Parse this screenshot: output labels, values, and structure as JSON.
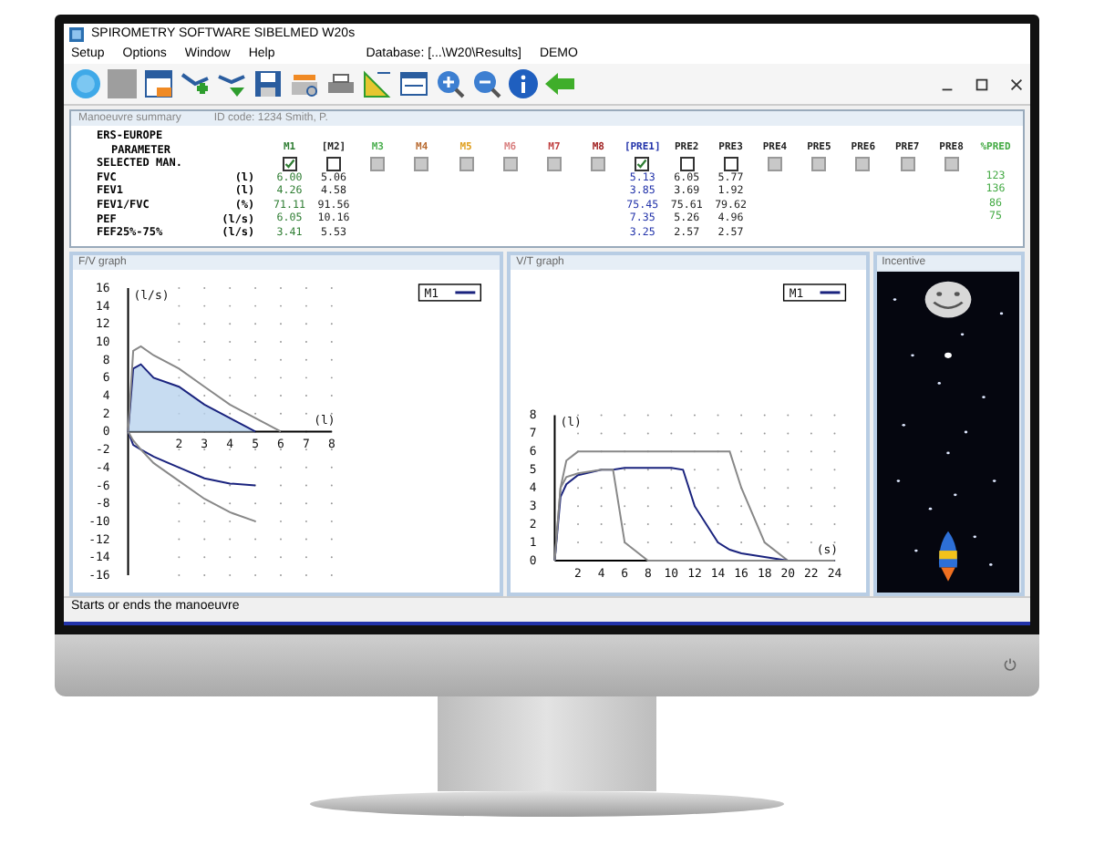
{
  "window": {
    "title": "SPIROMETRY SOFTWARE SIBELMED W20s"
  },
  "menu": [
    "Setup",
    "Options",
    "Window",
    "Help"
  ],
  "database": "Database: [...\\W20\\Results]",
  "mode": "DEMO",
  "summary": {
    "title": "Manoeuvre summary",
    "patient": "ID code: 1234 Smith, P.",
    "standard": "ERS-EUROPE",
    "parameter_label": "PARAMETER",
    "selected_label": "SELECTED MAN.",
    "rows": [
      {
        "name": "FVC",
        "unit": "(l)"
      },
      {
        "name": "FEV1",
        "unit": "(l)"
      },
      {
        "name": "FEV1/FVC",
        "unit": "(%)"
      },
      {
        "name": "PEF",
        "unit": "(l/s)"
      },
      {
        "name": "FEF25%-75%",
        "unit": "(l/s)"
      }
    ],
    "columns": [
      {
        "label": "M1",
        "color": "#2e7d32",
        "checked": true,
        "disabled": false,
        "values": [
          "6.00",
          "4.26",
          "71.11",
          "6.05",
          "3.41"
        ]
      },
      {
        "label": "[M2]",
        "color": "#222222",
        "checked": false,
        "disabled": false,
        "values": [
          "5.06",
          "4.58",
          "91.56",
          "10.16",
          "5.53"
        ]
      },
      {
        "label": "M3",
        "color": "#4caf50",
        "checked": false,
        "disabled": true
      },
      {
        "label": "M4",
        "color": "#b86a30",
        "checked": false,
        "disabled": true
      },
      {
        "label": "M5",
        "color": "#e0a020",
        "checked": false,
        "disabled": true
      },
      {
        "label": "M6",
        "color": "#d98080",
        "checked": false,
        "disabled": true
      },
      {
        "label": "M7",
        "color": "#c04040",
        "checked": false,
        "disabled": true
      },
      {
        "label": "M8",
        "color": "#a02020",
        "checked": false,
        "disabled": true
      },
      {
        "label": "[PRE1]",
        "color": "#2233aa",
        "checked": true,
        "disabled": false,
        "values": [
          "5.13",
          "3.85",
          "75.45",
          "7.35",
          "3.25"
        ]
      },
      {
        "label": "PRE2",
        "color": "#222222",
        "checked": false,
        "disabled": false,
        "values": [
          "6.05",
          "3.69",
          "75.61",
          "5.26",
          "2.57"
        ]
      },
      {
        "label": "PRE3",
        "color": "#222222",
        "checked": false,
        "disabled": false,
        "values": [
          "5.77",
          "1.92",
          "79.62",
          "4.96",
          "2.57"
        ]
      },
      {
        "label": "PRE4",
        "color": "#222222",
        "checked": false,
        "disabled": true
      },
      {
        "label": "PRE5",
        "color": "#222222",
        "checked": false,
        "disabled": true
      },
      {
        "label": "PRE6",
        "color": "#222222",
        "checked": false,
        "disabled": true
      },
      {
        "label": "PRE7",
        "color": "#222222",
        "checked": false,
        "disabled": true
      },
      {
        "label": "PRE8",
        "color": "#222222",
        "checked": false,
        "disabled": true
      },
      {
        "label": "%PRED",
        "color": "#44aa44",
        "values": [
          "123",
          "136",
          "86",
          "75"
        ]
      }
    ]
  },
  "fv_graph": {
    "title": "F/V graph",
    "chart_data": {
      "type": "line",
      "xlabel": "(l)",
      "ylabel": "(l/s)",
      "x": [
        0,
        0.2,
        0.5,
        1,
        2,
        3,
        4,
        5,
        6
      ],
      "xlim": [
        0,
        8
      ],
      "ylim": [
        -16,
        16
      ],
      "xticks": [
        2,
        3,
        4,
        5,
        6,
        7,
        8
      ],
      "yticks": [
        -16,
        -14,
        -12,
        -10,
        -8,
        -6,
        -4,
        -2,
        0,
        2,
        4,
        6,
        8,
        10,
        12,
        14,
        16
      ],
      "series": [
        {
          "name": "M1",
          "color": "#1a237e",
          "values": [
            0,
            7,
            7.5,
            6,
            5,
            3,
            1.5,
            0,
            null
          ]
        },
        {
          "color": "#1a237e",
          "values": [
            0,
            -1.5,
            -2,
            -2.8,
            -4,
            -5.2,
            -5.8,
            -6,
            null
          ]
        },
        {
          "color": "#888888",
          "values": [
            0,
            9,
            9.5,
            8.5,
            7,
            5,
            3,
            1.5,
            0
          ]
        },
        {
          "color": "#888888",
          "values": [
            0,
            -1,
            -2,
            -3.5,
            -5.5,
            -7.5,
            -9,
            -10,
            null
          ]
        }
      ]
    }
  },
  "vt_graph": {
    "title": "V/T graph",
    "chart_data": {
      "type": "line",
      "xlabel": "(s)",
      "ylabel": "(l)",
      "x": [
        0,
        0.5,
        1,
        2,
        4,
        5,
        6,
        8,
        10,
        11,
        12,
        14,
        15,
        16,
        18,
        20,
        24
      ],
      "xlim": [
        0,
        24
      ],
      "ylim": [
        0,
        8
      ],
      "xticks": [
        2,
        4,
        6,
        8,
        10,
        12,
        14,
        16,
        18,
        20,
        22,
        24
      ],
      "yticks": [
        0,
        1,
        2,
        3,
        4,
        5,
        6,
        7,
        8
      ],
      "series": [
        {
          "color": "#888888",
          "values": [
            0,
            4,
            5.5,
            6,
            6,
            6,
            6,
            6,
            6,
            6,
            6,
            6,
            6,
            4,
            1,
            0,
            0
          ]
        },
        {
          "name": "M1",
          "color": "#1a237e",
          "values": [
            0,
            3.5,
            4.2,
            4.7,
            5,
            5,
            5.1,
            5.1,
            5.1,
            5,
            3,
            1,
            0.6,
            0.4,
            0.2,
            0,
            0
          ]
        },
        {
          "color": "#888888",
          "values": [
            0,
            4,
            4.6,
            4.8,
            5,
            5,
            1,
            0,
            0,
            0,
            0,
            0,
            0,
            0,
            0,
            0,
            0
          ]
        }
      ]
    }
  },
  "incentive": {
    "title": "Incentive"
  },
  "status_bar": "Starts or ends the manoeuvre"
}
